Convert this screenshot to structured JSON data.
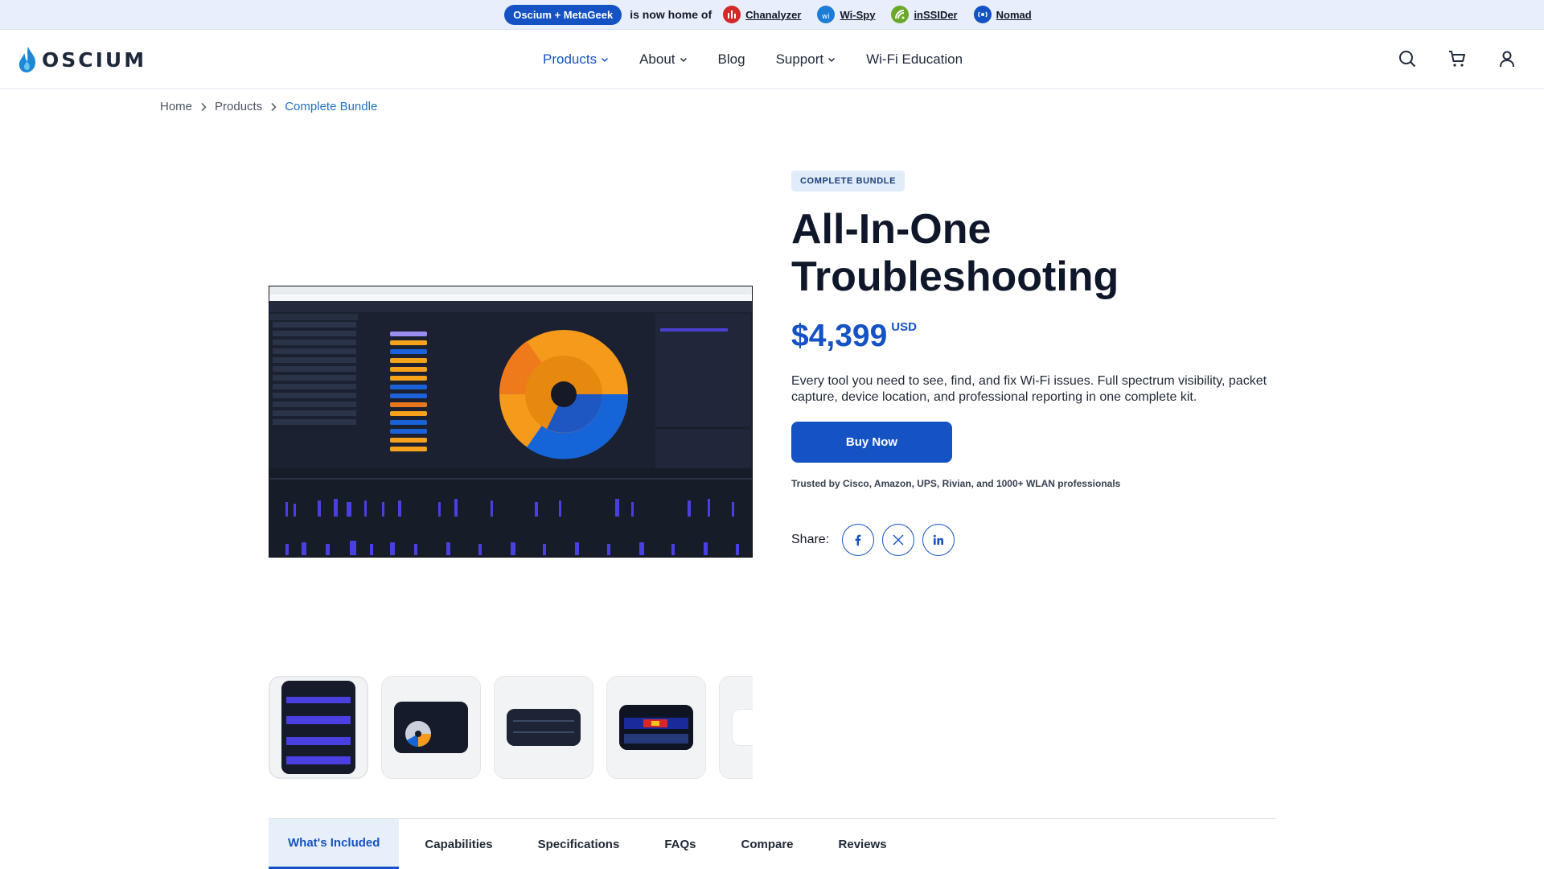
{
  "announce": {
    "pill": "Oscium + MetaGeek",
    "home_text": "is now home of",
    "brands": [
      {
        "label": "Chanalyzer",
        "color": "#d62828",
        "icon": "chanalyzer-icon"
      },
      {
        "label": "Wi-Spy",
        "color": "#1d7dd6",
        "icon": "wi-spy-icon"
      },
      {
        "label": "inSSIDer",
        "color": "#6aa82c",
        "icon": "inssider-icon"
      },
      {
        "label": "Nomad",
        "color": "#1552c4",
        "icon": "nomad-icon"
      }
    ]
  },
  "header": {
    "logo": "OSCIUM",
    "nav": [
      {
        "label": "Products",
        "dropdown": true
      },
      {
        "label": "About",
        "dropdown": true
      },
      {
        "label": "Blog",
        "dropdown": false
      },
      {
        "label": "Support",
        "dropdown": true
      },
      {
        "label": "Wi-Fi Education",
        "dropdown": false
      }
    ],
    "icons": [
      "search-icon",
      "cart-icon",
      "account-icon"
    ]
  },
  "breadcrumb": [
    "Home",
    "Products",
    "Complete Bundle"
  ],
  "product": {
    "badge": "COMPLETE BUNDLE",
    "title": "All-In-One Troubleshooting",
    "price": "$4,399",
    "currency": "USD",
    "description": "Every tool you need to see, find, and fix Wi-Fi issues. Full spectrum visibility, packet capture, device location, and professional reporting in one complete kit.",
    "buy_label": "Buy Now",
    "trusted": "Trusted by Cisco, Amazon, UPS, Rivian, and 1000+ WLAN professionals",
    "share_label": "Share:",
    "share_icons": [
      "facebook-icon",
      "x-icon",
      "linkedin-icon"
    ]
  },
  "tabs": [
    {
      "label": "What's Included",
      "active": true
    },
    {
      "label": "Capabilities",
      "active": false
    },
    {
      "label": "Specifications",
      "active": false
    },
    {
      "label": "FAQs",
      "active": false
    },
    {
      "label": "Compare",
      "active": false
    },
    {
      "label": "Reviews",
      "active": false
    }
  ],
  "colors": {
    "accent": "#1552c4",
    "announce_bg": "#e8eefb",
    "tab_active_bg": "#e7effb"
  }
}
